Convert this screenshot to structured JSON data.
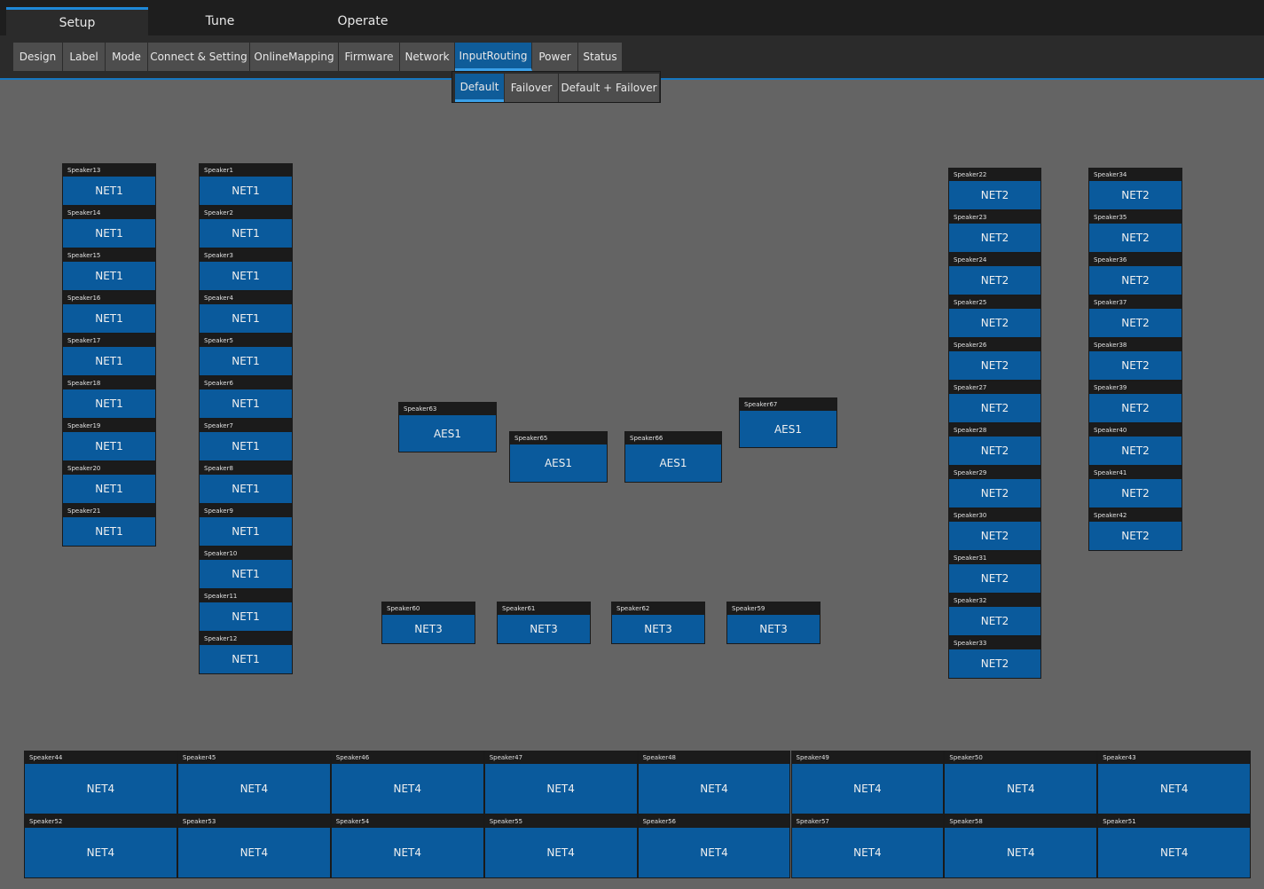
{
  "main_tabs": [
    {
      "label": "Setup",
      "active": true
    },
    {
      "label": "Tune",
      "active": false
    },
    {
      "label": "Operate",
      "active": false
    }
  ],
  "sub_tabs": [
    {
      "label": "Design",
      "active": false
    },
    {
      "label": "Label",
      "active": false
    },
    {
      "label": "Mode",
      "active": false
    },
    {
      "label": "Connect & Setting",
      "active": false
    },
    {
      "label": "OnlineMapping",
      "active": false
    },
    {
      "label": "Firmware",
      "active": false
    },
    {
      "label": "Network",
      "active": false
    },
    {
      "label": "InputRouting",
      "active": true
    },
    {
      "label": "Power",
      "active": false
    },
    {
      "label": "Status",
      "active": false
    }
  ],
  "routing_options": [
    {
      "label": "Default",
      "active": true
    },
    {
      "label": "Failover",
      "active": false
    },
    {
      "label": "Default + Failover",
      "active": false
    }
  ],
  "colors": {
    "accent": "#1e88d8",
    "speaker_fill": "#0a5a9c",
    "background": "#646464"
  },
  "speaker_groups": [
    {
      "group": "left-column-a",
      "speakers": [
        {
          "name": "Speaker13",
          "source": "NET1"
        },
        {
          "name": "Speaker14",
          "source": "NET1"
        },
        {
          "name": "Speaker15",
          "source": "NET1"
        },
        {
          "name": "Speaker16",
          "source": "NET1"
        },
        {
          "name": "Speaker17",
          "source": "NET1"
        },
        {
          "name": "Speaker18",
          "source": "NET1"
        },
        {
          "name": "Speaker19",
          "source": "NET1"
        },
        {
          "name": "Speaker20",
          "source": "NET1"
        },
        {
          "name": "Speaker21",
          "source": "NET1"
        }
      ]
    },
    {
      "group": "left-column-b",
      "speakers": [
        {
          "name": "Speaker1",
          "source": "NET1"
        },
        {
          "name": "Speaker2",
          "source": "NET1"
        },
        {
          "name": "Speaker3",
          "source": "NET1"
        },
        {
          "name": "Speaker4",
          "source": "NET1"
        },
        {
          "name": "Speaker5",
          "source": "NET1"
        },
        {
          "name": "Speaker6",
          "source": "NET1"
        },
        {
          "name": "Speaker7",
          "source": "NET1"
        },
        {
          "name": "Speaker8",
          "source": "NET1"
        },
        {
          "name": "Speaker9",
          "source": "NET1"
        },
        {
          "name": "Speaker10",
          "source": "NET1"
        },
        {
          "name": "Speaker11",
          "source": "NET1"
        },
        {
          "name": "Speaker12",
          "source": "NET1"
        }
      ]
    },
    {
      "group": "right-column-a",
      "speakers": [
        {
          "name": "Speaker22",
          "source": "NET2"
        },
        {
          "name": "Speaker23",
          "source": "NET2"
        },
        {
          "name": "Speaker24",
          "source": "NET2"
        },
        {
          "name": "Speaker25",
          "source": "NET2"
        },
        {
          "name": "Speaker26",
          "source": "NET2"
        },
        {
          "name": "Speaker27",
          "source": "NET2"
        },
        {
          "name": "Speaker28",
          "source": "NET2"
        },
        {
          "name": "Speaker29",
          "source": "NET2"
        },
        {
          "name": "Speaker30",
          "source": "NET2"
        },
        {
          "name": "Speaker31",
          "source": "NET2"
        },
        {
          "name": "Speaker32",
          "source": "NET2"
        },
        {
          "name": "Speaker33",
          "source": "NET2"
        }
      ]
    },
    {
      "group": "right-column-b",
      "speakers": [
        {
          "name": "Speaker34",
          "source": "NET2"
        },
        {
          "name": "Speaker35",
          "source": "NET2"
        },
        {
          "name": "Speaker36",
          "source": "NET2"
        },
        {
          "name": "Speaker37",
          "source": "NET2"
        },
        {
          "name": "Speaker38",
          "source": "NET2"
        },
        {
          "name": "Speaker39",
          "source": "NET2"
        },
        {
          "name": "Speaker40",
          "source": "NET2"
        },
        {
          "name": "Speaker41",
          "source": "NET2"
        },
        {
          "name": "Speaker42",
          "source": "NET2"
        }
      ]
    },
    {
      "group": "aes-center",
      "speakers": [
        {
          "name": "Speaker63",
          "source": "AES1"
        },
        {
          "name": "Speaker65",
          "source": "AES1"
        },
        {
          "name": "Speaker66",
          "source": "AES1"
        },
        {
          "name": "Speaker67",
          "source": "AES1"
        }
      ]
    },
    {
      "group": "net3-center",
      "speakers": [
        {
          "name": "Speaker60",
          "source": "NET3"
        },
        {
          "name": "Speaker61",
          "source": "NET3"
        },
        {
          "name": "Speaker62",
          "source": "NET3"
        },
        {
          "name": "Speaker59",
          "source": "NET3"
        }
      ]
    },
    {
      "group": "bottom-row-1",
      "speakers": [
        {
          "name": "Speaker44",
          "source": "NET4"
        },
        {
          "name": "Speaker45",
          "source": "NET4"
        },
        {
          "name": "Speaker46",
          "source": "NET4"
        },
        {
          "name": "Speaker47",
          "source": "NET4"
        },
        {
          "name": "Speaker48",
          "source": "NET4"
        },
        {
          "name": "Speaker49",
          "source": "NET4"
        },
        {
          "name": "Speaker50",
          "source": "NET4"
        },
        {
          "name": "Speaker43",
          "source": "NET4"
        }
      ]
    },
    {
      "group": "bottom-row-2",
      "speakers": [
        {
          "name": "Speaker52",
          "source": "NET4"
        },
        {
          "name": "Speaker53",
          "source": "NET4"
        },
        {
          "name": "Speaker54",
          "source": "NET4"
        },
        {
          "name": "Speaker55",
          "source": "NET4"
        },
        {
          "name": "Speaker56",
          "source": "NET4"
        },
        {
          "name": "Speaker57",
          "source": "NET4"
        },
        {
          "name": "Speaker58",
          "source": "NET4"
        },
        {
          "name": "Speaker51",
          "source": "NET4"
        }
      ]
    }
  ]
}
